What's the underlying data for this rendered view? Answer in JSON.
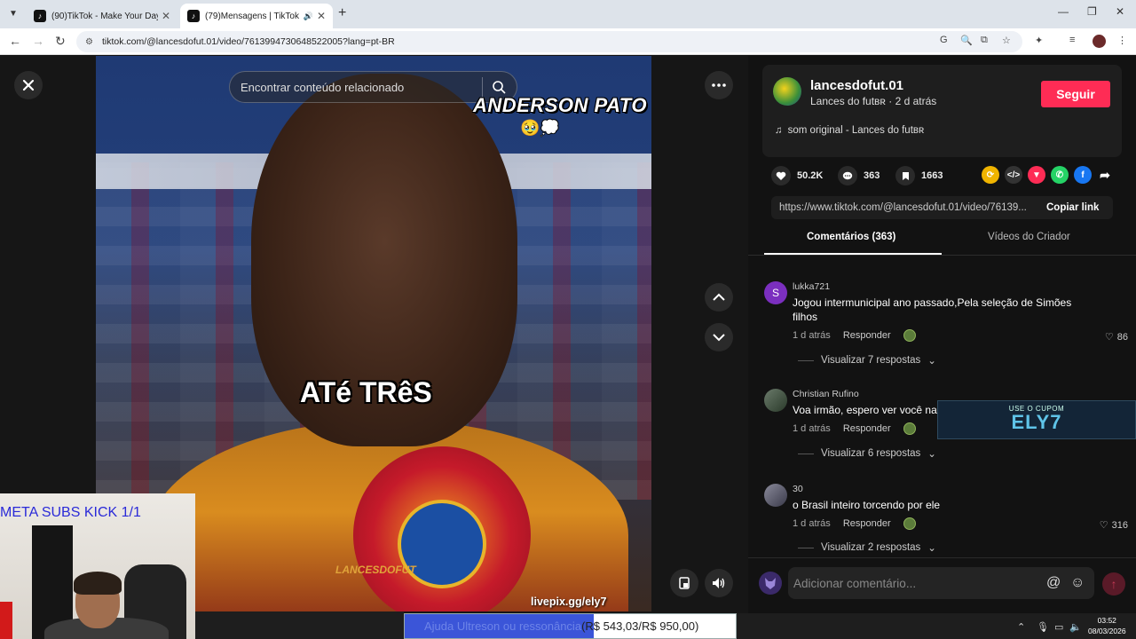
{
  "browser": {
    "tabs": [
      {
        "label": "(90)TikTok - Make Your Day",
        "active": false
      },
      {
        "label": "(79)Mensagens | TikTok",
        "active": true
      }
    ],
    "url": "tiktok.com/@lancesdofut.01/video/7613994730648522005?lang=pt-BR"
  },
  "video": {
    "search_placeholder": "Encontrar conteúdo relacionado",
    "caption_top": "ANDERSON PATO",
    "caption_emoji": "🥹💭",
    "caption_mid": "ATé TRêS",
    "watermark": "LANCESDOFUT",
    "livepix": "livepix.gg/ely7"
  },
  "webcam": {
    "overlay_text": "META SUBS KICK 1/1"
  },
  "donation": {
    "label": "Ajuda Ultreson ou ressonância",
    "amount": "(R$ 543,03/R$ 950,00)",
    "progress": 0.5716
  },
  "author": {
    "username": "lancesdofut.01",
    "subtitle": "Lances do futʙʀ · 2 d atrás",
    "follow_label": "Seguir",
    "music": "som original - Lances do futʙʀ"
  },
  "stats": {
    "likes": "50.2K",
    "comments": "363",
    "saves": "1663"
  },
  "share": {
    "link": "https://www.tiktok.com/@lancesdofut.01/video/76139...",
    "copy_label": "Copiar link"
  },
  "panel_tabs": {
    "comments": "Comentários (363)",
    "creator": "Vídeos do Criador"
  },
  "comments": [
    {
      "user": "lukka721",
      "initial": "S",
      "text": "Jogou intermunicipal ano passado,Pela seleção de Simões filhos",
      "time": "1 d atrás",
      "reply": "Responder",
      "likes": "86",
      "more": "Visualizar 7 respostas"
    },
    {
      "user": "Christian Rufino",
      "text": "Voa irmão, espero ver você na",
      "time": "1 d atrás",
      "reply": "Responder",
      "likes": "",
      "more": "Visualizar 6 respostas"
    },
    {
      "user": "30",
      "text": "o Brasil inteiro torcendo por ele",
      "time": "1 d atrás",
      "reply": "Responder",
      "likes": "316",
      "more": "Visualizar 2 respostas"
    }
  ],
  "coupon": {
    "small": "USE O CUPOM",
    "code": "ELY7"
  },
  "comment_input": {
    "placeholder": "Adicionar comentário..."
  },
  "clock": {
    "time": "03:52",
    "date": "08/03/2026"
  },
  "colors": {
    "accent": "#fe2c55",
    "coupon": "#5fc4e8",
    "donation_fill": "#3b55d8"
  }
}
